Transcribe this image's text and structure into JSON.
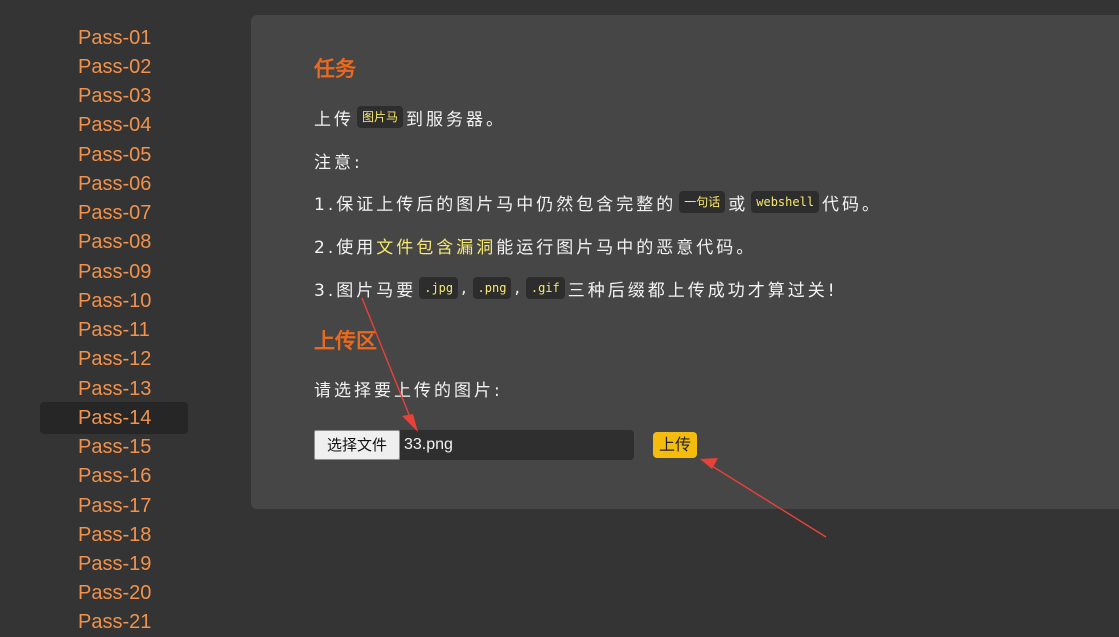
{
  "sidebar": {
    "items": [
      {
        "label": "Pass-01"
      },
      {
        "label": "Pass-02"
      },
      {
        "label": "Pass-03"
      },
      {
        "label": "Pass-04"
      },
      {
        "label": "Pass-05"
      },
      {
        "label": "Pass-06"
      },
      {
        "label": "Pass-07"
      },
      {
        "label": "Pass-08"
      },
      {
        "label": "Pass-09"
      },
      {
        "label": "Pass-10"
      },
      {
        "label": "Pass-11"
      },
      {
        "label": "Pass-12"
      },
      {
        "label": "Pass-13"
      },
      {
        "label": "Pass-14"
      },
      {
        "label": "Pass-15"
      },
      {
        "label": "Pass-16"
      },
      {
        "label": "Pass-17"
      },
      {
        "label": "Pass-18"
      },
      {
        "label": "Pass-19"
      },
      {
        "label": "Pass-20"
      },
      {
        "label": "Pass-21"
      }
    ],
    "active": "Pass-14"
  },
  "task": {
    "heading": "任务",
    "line1": {
      "before": "上传",
      "code": "图片马",
      "after": "到服务器。"
    },
    "note": "注意:",
    "item1": {
      "before": "1.保证上传后的图片马中仍然包含完整的",
      "code1": "一句话",
      "mid": "或",
      "code2": "webshell",
      "after": "代码。"
    },
    "item2": {
      "before": "2.使用",
      "highlight": "文件包含漏洞",
      "after": "能运行图片马中的恶意代码。"
    },
    "item3": {
      "before": "3.图片马要",
      "code1": ".jpg",
      "sep1": ",",
      "code2": ".png",
      "sep2": ",",
      "code3": ".gif",
      "after": "三种后缀都上传成功才算过关!"
    }
  },
  "upload": {
    "heading": "上传区",
    "prompt": "请选择要上传的图片:",
    "choose_file_label": "选择文件",
    "file_name": "33.png",
    "submit_label": "上传"
  },
  "colors": {
    "page_bg": "#343434",
    "panel_bg": "#464646",
    "sidebar_text": "#f2924c",
    "heading": "#e8691f",
    "code_text": "#f7e96e",
    "upload_button": "#f4bd0e",
    "annotation_arrow": "#e8413a"
  }
}
